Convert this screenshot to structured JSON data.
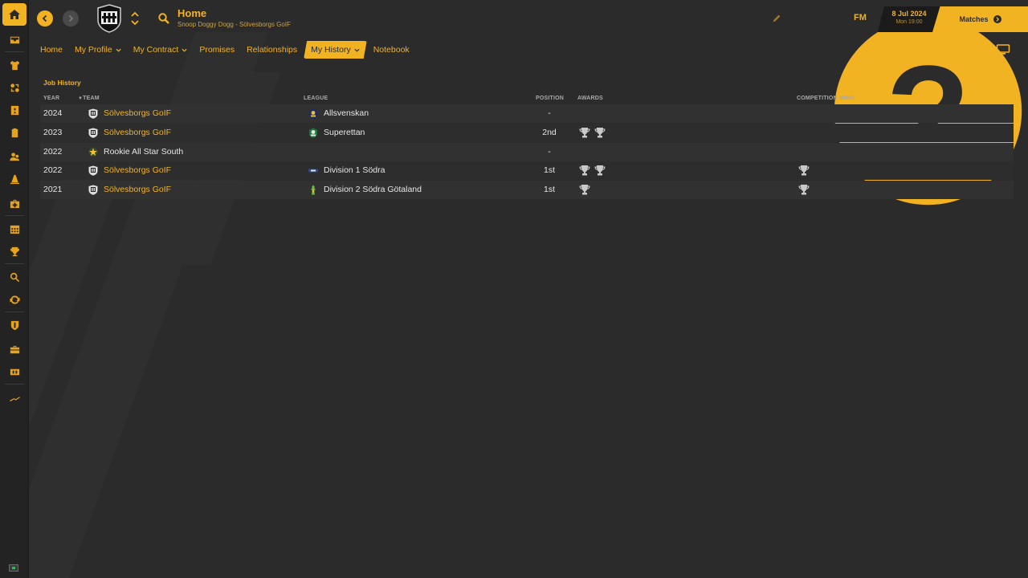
{
  "header": {
    "title": "Home",
    "subtitle": "Snoop Doggy Dogg - Sölvesborgs GoIF",
    "fm_logo": "FM",
    "date": "8 Jul 2024",
    "time": "Mon 19:00",
    "matches_label": "Matches"
  },
  "tabs": [
    {
      "label": "Home",
      "dropdown": false,
      "active": false
    },
    {
      "label": "My Profile",
      "dropdown": true,
      "active": false
    },
    {
      "label": "My Contract",
      "dropdown": true,
      "active": false
    },
    {
      "label": "Promises",
      "dropdown": false,
      "active": false
    },
    {
      "label": "Relationships",
      "dropdown": false,
      "active": false
    },
    {
      "label": "My History",
      "dropdown": true,
      "active": true
    },
    {
      "label": "Notebook",
      "dropdown": false,
      "active": false
    }
  ],
  "job_history": {
    "title": "Job History",
    "columns": {
      "year": "YEAR",
      "team": "TEAM",
      "league": "LEAGUE",
      "position": "POSITION",
      "awards": "AWARDS",
      "competition_wins": "COMPETITION WINS"
    },
    "rows": [
      {
        "year": "2024",
        "team": "Sölvesborgs GoIF",
        "team_link": true,
        "team_badge": "club-badge-icon",
        "league": "Allsvenskan",
        "league_badge": "allsvenskan-badge-icon",
        "position": "-",
        "awards": 0,
        "competition_wins": 0
      },
      {
        "year": "2023",
        "team": "Sölvesborgs GoIF",
        "team_link": true,
        "team_badge": "club-badge-icon",
        "league": "Superettan",
        "league_badge": "superettan-badge-icon",
        "position": "2nd",
        "awards": 2,
        "competition_wins": 0
      },
      {
        "year": "2022",
        "team": "Rookie All Star South",
        "team_link": false,
        "team_badge": "all-star-badge-icon",
        "league": "",
        "league_badge": "",
        "position": "-",
        "awards": 0,
        "competition_wins": 0
      },
      {
        "year": "2022",
        "team": "Sölvesborgs GoIF",
        "team_link": true,
        "team_badge": "club-badge-icon",
        "league": "Division 1 Södra",
        "league_badge": "division1-badge-icon",
        "position": "1st",
        "awards": 2,
        "competition_wins": 1
      },
      {
        "year": "2021",
        "team": "Sölvesborgs GoIF",
        "team_link": true,
        "team_badge": "club-badge-icon",
        "league": "Division 2 Södra Götaland",
        "league_badge": "division2-badge-icon",
        "position": "1st",
        "awards": 1,
        "competition_wins": 1
      }
    ]
  },
  "colors": {
    "accent": "#f2b322",
    "background": "#2b2b2b",
    "rail": "#232323"
  }
}
